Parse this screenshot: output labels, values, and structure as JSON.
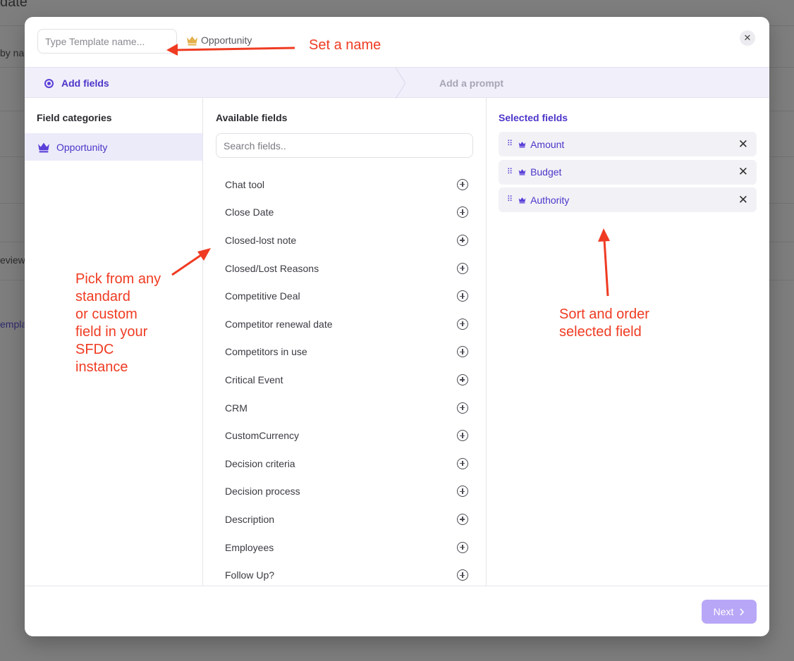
{
  "background": {
    "title_partial": "date",
    "row1_partial": "by na",
    "row2_partial": "eview",
    "row3_partial": "empla"
  },
  "modal": {
    "name_placeholder": "Type Template name...",
    "object_tag": "Opportunity",
    "close_icon": "close-icon",
    "steps": [
      "Add fields",
      "Add a prompt"
    ],
    "categories": {
      "heading": "Field categories",
      "items": [
        {
          "label": "Opportunity",
          "icon": "crown-icon"
        }
      ]
    },
    "available": {
      "heading": "Available fields",
      "search_placeholder": "Search fields..",
      "fields": [
        "Chat tool",
        "Close Date",
        "Closed-lost note",
        "Closed/Lost Reasons",
        "Competitive Deal",
        "Competitor renewal date",
        "Competitors in use",
        "Critical Event",
        "CRM",
        "CustomCurrency",
        "Decision criteria",
        "Decision process",
        "Description",
        "Employees",
        "Follow Up?"
      ]
    },
    "selected": {
      "heading": "Selected fields",
      "fields": [
        "Amount",
        "Budget",
        "Authority"
      ]
    },
    "footer": {
      "next_label": "Next"
    }
  },
  "annotations": {
    "set_name": "Set a name",
    "pick_lines": [
      "Pick from any",
      "standard",
      "or custom",
      "field in your",
      "SFDC",
      "instance"
    ],
    "sort_lines": [
      "Sort and order",
      "selected field"
    ]
  },
  "colors": {
    "accent": "#4b35c9",
    "annotation": "#ef3b22",
    "crown_gold": "#e3b04b",
    "next_button": "#b8a7f7"
  }
}
